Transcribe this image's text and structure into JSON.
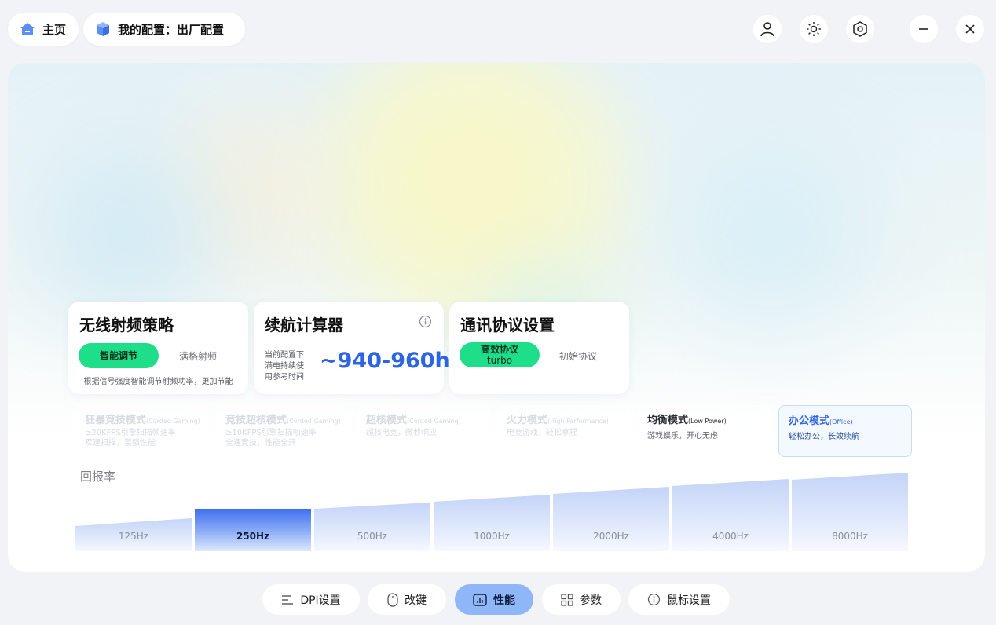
{
  "header": {
    "home_label": "主页",
    "config_label": "我的配置：出厂配置"
  },
  "rf_strategy": {
    "title": "无线射频策略",
    "option_active": "智能调节",
    "option_inactive": "满格射频",
    "description": "根据信号强度智能调节射频功率，更加节能"
  },
  "battery_calc": {
    "title": "续航计算器",
    "note_line1": "当前配置下",
    "note_line2": "满电持续使",
    "note_line3": "用参考时间",
    "value": "~940-960h"
  },
  "protocol": {
    "title": "通讯协议设置",
    "option_active_line1": "高效协议",
    "option_active_line2": "turbo",
    "option_inactive": "初始协议"
  },
  "modes": [
    {
      "name": "狂暴竞技模式",
      "en": "(Corded Gaming)",
      "desc1": "≥20KFPS引擎扫描帧速率",
      "desc2": "疾速扫描，至强性能"
    },
    {
      "name": "竞技超核模式",
      "en": "(Corded Gaming)",
      "desc1": "≥10KFPS引擎扫描帧速率",
      "desc2": "全速竞技，性能全开"
    },
    {
      "name": "超核模式",
      "en": "(Corded Gaming)",
      "desc1": "超核电竞，微秒响应",
      "desc2": ""
    },
    {
      "name": "火力模式",
      "en": "(High Performance)",
      "desc1": "电竞游戏，轻松拿捏",
      "desc2": ""
    },
    {
      "name": "均衡模式",
      "en": "(Low Power)",
      "desc1": "游戏娱乐，开心无虑",
      "desc2": ""
    },
    {
      "name": "办公模式",
      "en": "(Office)",
      "desc1": "轻松办公，长效续航",
      "desc2": ""
    }
  ],
  "polling": {
    "label": "回报率",
    "rates": [
      "125Hz",
      "250Hz",
      "500Hz",
      "1000Hz",
      "2000Hz",
      "4000Hz",
      "8000Hz"
    ],
    "selected": "250Hz"
  },
  "nav": {
    "dpi": "DPI设置",
    "keys": "改键",
    "performance": "性能",
    "params": "参数",
    "mouse": "鼠标设置"
  },
  "colors": {
    "accent_green": "#1ede8a",
    "accent_blue": "#2b64e4",
    "selected_bar": "#3f6ff0",
    "nav_active": "#8fb6f7"
  }
}
